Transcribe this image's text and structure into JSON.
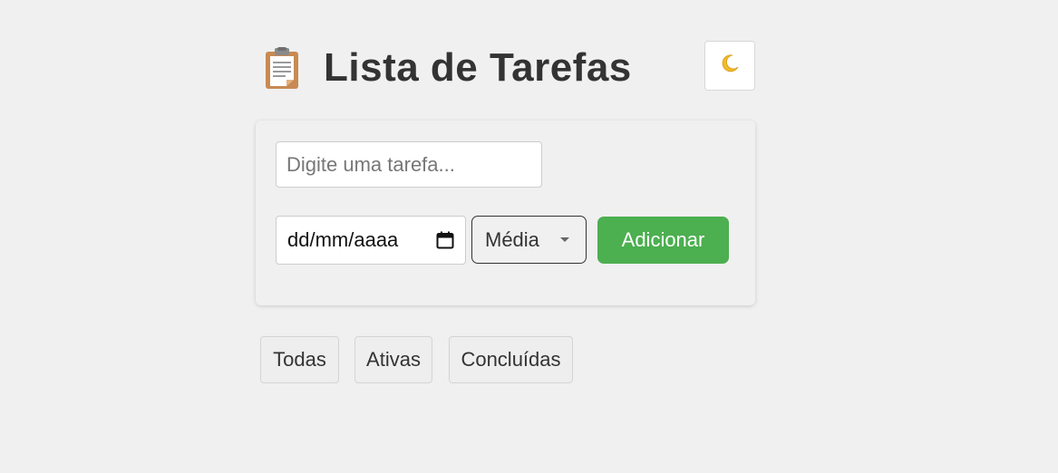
{
  "header": {
    "title": "Lista de Tarefas",
    "icon": "clipboard-icon",
    "theme_toggle_icon": "moon-icon"
  },
  "form": {
    "task_input": {
      "placeholder": "Digite uma tarefa...",
      "value": ""
    },
    "date_input": {
      "display": "dd/mm/aaaa",
      "icon": "calendar-icon"
    },
    "priority_select": {
      "selected": "Média"
    },
    "add_button_label": "Adicionar"
  },
  "filters": [
    {
      "label": "Todas"
    },
    {
      "label": "Ativas"
    },
    {
      "label": "Concluídas"
    }
  ],
  "colors": {
    "background": "#f0f0f0",
    "accent": "#4caf50",
    "text": "#333333"
  }
}
